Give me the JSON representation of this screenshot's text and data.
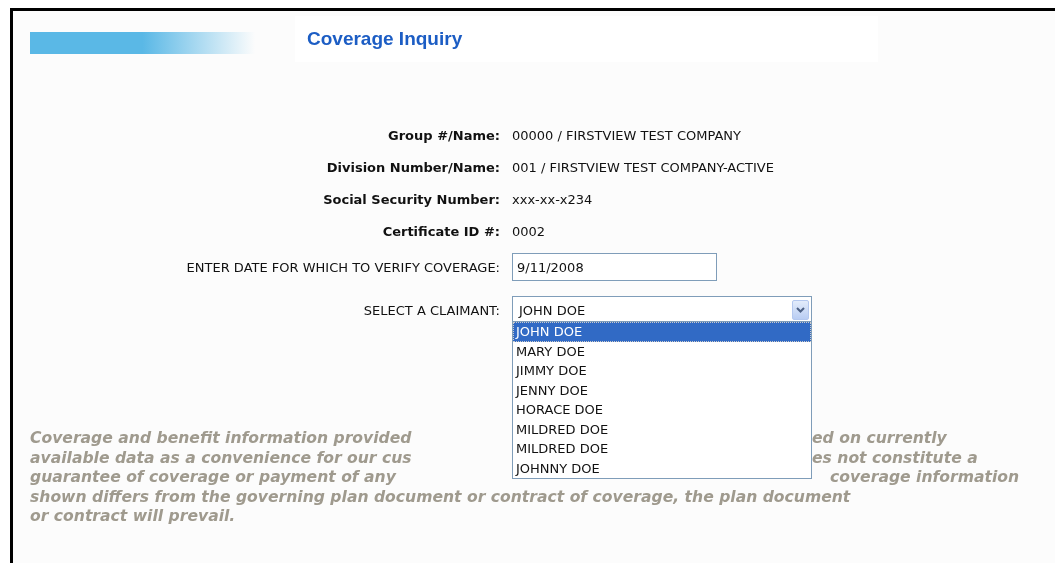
{
  "title": "Coverage Inquiry",
  "info": [
    {
      "label": "Group #/Name:",
      "value": "00000 / FIRSTVIEW TEST COMPANY"
    },
    {
      "label": "Division Number/Name:",
      "value": "001 / FIRSTVIEW TEST COMPANY-ACTIVE"
    },
    {
      "label": "Social Security Number:",
      "value": "xxx-xx-x234"
    },
    {
      "label": "Certificate ID #:",
      "value": "0002"
    }
  ],
  "date_field": {
    "label": "ENTER DATE FOR WHICH TO VERIFY COVERAGE:",
    "value": "9/11/2008"
  },
  "claimant": {
    "label": "SELECT A CLAIMANT:",
    "value": "JOHN DOE",
    "expanded": true,
    "options": [
      {
        "label": "JOHN DOE",
        "selected": true
      },
      {
        "label": "MARY DOE",
        "selected": false
      },
      {
        "label": "JIMMY DOE",
        "selected": false
      },
      {
        "label": "JENNY DOE",
        "selected": false
      },
      {
        "label": "HORACE DOE",
        "selected": false
      },
      {
        "label": "MILDRED DOE",
        "selected": false
      },
      {
        "label": "MILDRED DOE",
        "selected": false
      },
      {
        "label": "JOHNNY DOE",
        "selected": false
      }
    ]
  },
  "disclaimer": [
    [
      "Coverage and benefit information provided",
      "ed on currently"
    ],
    [
      "available data as a convenience for our cus",
      "es not constitute a"
    ],
    [
      "guarantee of coverage or payment of any",
      "coverage information"
    ],
    [
      "shown differs from the governing plan document or contract of coverage, the plan document"
    ],
    [
      "or contract will prevail."
    ]
  ]
}
